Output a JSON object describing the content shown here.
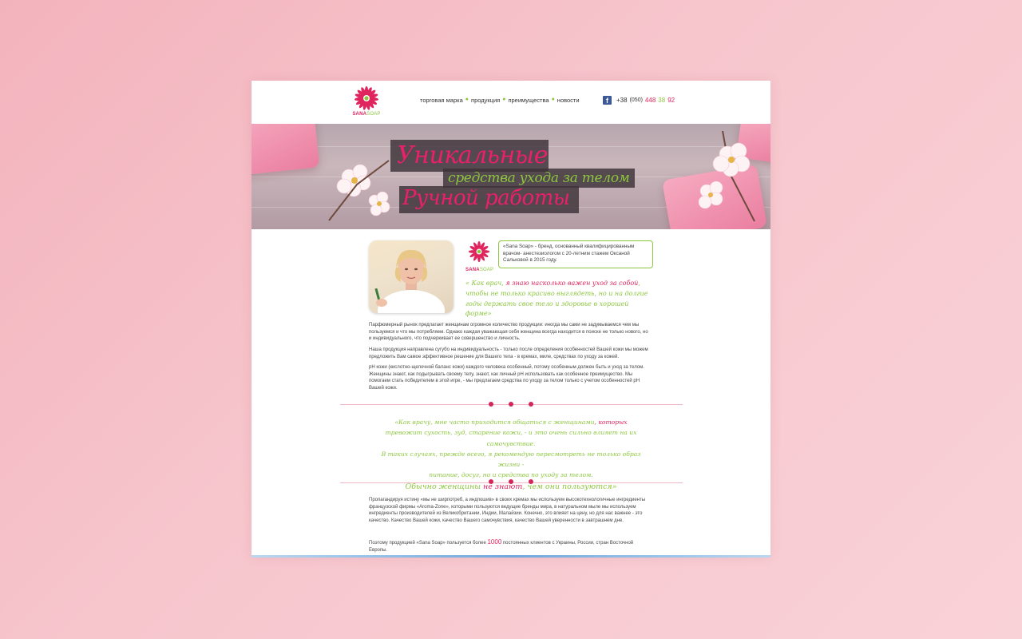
{
  "brand": {
    "name_part1": "SANA",
    "name_part2": "SOAP",
    "colors": {
      "pink": "#e0245e",
      "green": "#8cc63f",
      "facebook": "#3b5998"
    }
  },
  "nav": {
    "items": [
      {
        "label": "торговая марка"
      },
      {
        "label": "продукция"
      },
      {
        "label": "преимущества"
      },
      {
        "label": "новости"
      }
    ]
  },
  "contact": {
    "social_icon": "facebook-icon",
    "facebook_glyph": "f",
    "country_code": "+38",
    "operator_code": "(050)",
    "number_part1": "448",
    "number_part2": "38",
    "number_part3": "92"
  },
  "banner": {
    "line1": "Уникальные",
    "line2": "средства ухода за телом",
    "line3": "Ручной работы"
  },
  "intro": {
    "text": "«Sana Soap» - бренд, основанный квалифицированным врачом- анестезиологом с 20-летним стажем Оксаной Сальковой в 2015 году."
  },
  "quote1": {
    "open": "« Как врач, ",
    "highlight": "я знаю насколько важен уход за собой",
    "rest": ", чтобы не только красиво выглядеть, но и на долгие годы держать свое тело и здоровье в хорошей форме»"
  },
  "paragraphs": {
    "p1": "Парфюмерный рынок предлагает женщинам огромное количество продукции: иногда мы сами не задумываемся чем мы пользуемся и что мы потребляем. Однако каждая уважающая себя женщина всегда находится в поиске не только нового, но и индивидуального, что подчеркивает ее совершенство и личность.",
    "p2": "Наша продукция направлена сугубо на индивидуальность - только после определения особенностей Вашей кожи мы можем предложить Вам самое эффективное решение для Вашего тела - в кремах, миле, средствах по уходу за кожей.",
    "p3": "pH кожи (кислотно-щелочной баланс кожи) каждого человека особенный, потому особенным должен быть и уход за телом. Женщины знают, как подыгрывать своему телу, знают, как личный pH использовать как особенное преимущество. Мы помогаем стать победителем в этой игре, - мы предлагаем средства по уходу за телом только с учетом особенностей pH Вашей кожи.",
    "p4": "Пропагандируя истину «мы не ширпотреб, а индпошив» в своих кремах мы используем высокотехнологичные ингредиенты французской фирмы «Aroma-Zone», которыми пользуются ведущие бренды мира, в натуральном мыле мы используем ингредиенты производителей из Великобритании, Индии, Малайзии. Конечно, это влияет на цену, но для нас важнее - это качество. Качество Вашей кожи, качество Вашего самочувствия, качество Вашей уверенности в завтрашнем дне.",
    "p5_before": "Поэтому продукцией «Sana Soap» пользуется более ",
    "p5_number": "1000",
    "p5_after": " постоянных клиентов с Украины, России, стран Восточной Европы."
  },
  "quote2": {
    "l1_a": "«Как врачу, ",
    "l1_b": "мне часто приходится общаться с женщинами",
    "l1_c": ", которых",
    "l2": "тревожит сухость, зуд, старение кожи, - и это очень сильно влияет на их самочувствие.",
    "l3": "В таких случаях, прежде всего, я рекомендую пересмотреть не только образ жизни -",
    "l4": "питание, досуг, но и средства по уходу за телом.",
    "l5_a": "Обычно женщины ",
    "l5_b": "не знают",
    "l5_c": ", чем они пользуются»"
  }
}
